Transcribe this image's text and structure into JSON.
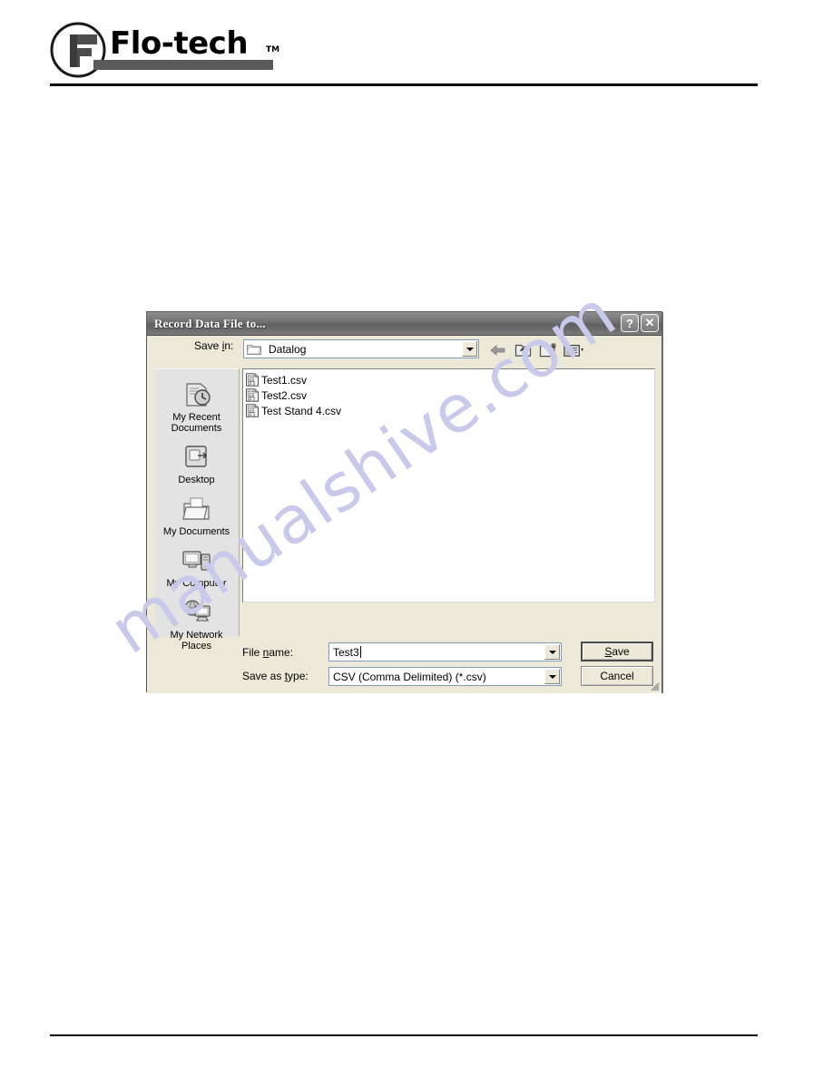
{
  "brand": {
    "name": "Flo-tech",
    "trademark": "TM",
    "logo_icon": "flo-tech-circle-f-logo"
  },
  "watermark": {
    "text": "manualshive.com",
    "color": "#c9c9ec"
  },
  "dialog": {
    "title": "Record Data File to...",
    "titlebar": {
      "help_label": "?",
      "close_label": "✕"
    },
    "savein": {
      "label": "Save in:",
      "value": "Datalog",
      "folder_icon": "folder-icon",
      "dropdown_icon": "chevron-down-icon"
    },
    "toolbar": [
      {
        "name": "back-button",
        "icon": "back-arrow-icon"
      },
      {
        "name": "up-one-level-button",
        "icon": "folder-up-icon"
      },
      {
        "name": "create-new-folder-button",
        "icon": "new-folder-icon"
      },
      {
        "name": "views-button",
        "icon": "views-list-icon"
      }
    ],
    "places": [
      {
        "label": "My Recent\nDocuments",
        "icon": "recent-documents-icon"
      },
      {
        "label": "Desktop",
        "icon": "desktop-icon"
      },
      {
        "label": "My Documents",
        "icon": "my-documents-icon"
      },
      {
        "label": "My Computer",
        "icon": "my-computer-icon"
      },
      {
        "label": "My Network\nPlaces",
        "icon": "network-places-icon"
      }
    ],
    "files": [
      {
        "name": "Test1.csv",
        "icon": "csv-file-icon"
      },
      {
        "name": "Test2.csv",
        "icon": "csv-file-icon"
      },
      {
        "name": "Test Stand 4.csv",
        "icon": "csv-file-icon"
      }
    ],
    "filename": {
      "label_before": "File ",
      "label_accel": "n",
      "label_after": "ame:",
      "value": "Test3"
    },
    "filetype": {
      "label_before": "Save as ",
      "label_accel": "t",
      "label_after": "ype:",
      "value": "CSV (Comma Delimited) (*.csv)"
    },
    "buttons": {
      "save_before": "",
      "save_accel": "S",
      "save_after": "ave",
      "cancel": "Cancel"
    }
  }
}
